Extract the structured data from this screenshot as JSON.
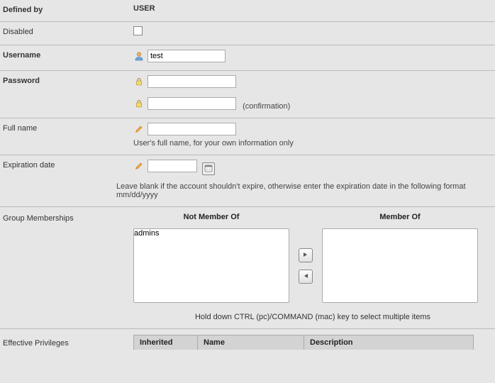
{
  "fields": {
    "defined_by": {
      "label": "Defined by",
      "value": "USER"
    },
    "disabled": {
      "label": "Disabled",
      "checked": false
    },
    "username": {
      "label": "Username",
      "value": "test"
    },
    "password": {
      "label": "Password",
      "value": "",
      "confirm_value": "",
      "confirm_text": "(confirmation)"
    },
    "fullname": {
      "label": "Full name",
      "value": "",
      "hint": "User's full name, for your own information only"
    },
    "expiration": {
      "label": "Expiration date",
      "value": "",
      "hint": "Leave blank if the account shouldn't expire, otherwise enter the expiration date in the following format mm/dd/yyyy"
    }
  },
  "groups": {
    "label": "Group Memberships",
    "not_member_heading": "Not Member Of",
    "member_heading": "Member Of",
    "not_member": [
      "admins"
    ],
    "member": [],
    "hint": "Hold down CTRL (pc)/COMMAND (mac) key to select multiple items"
  },
  "privileges": {
    "label": "Effective Privileges",
    "columns": {
      "inherited": "Inherited",
      "name": "Name",
      "description": "Description"
    }
  }
}
